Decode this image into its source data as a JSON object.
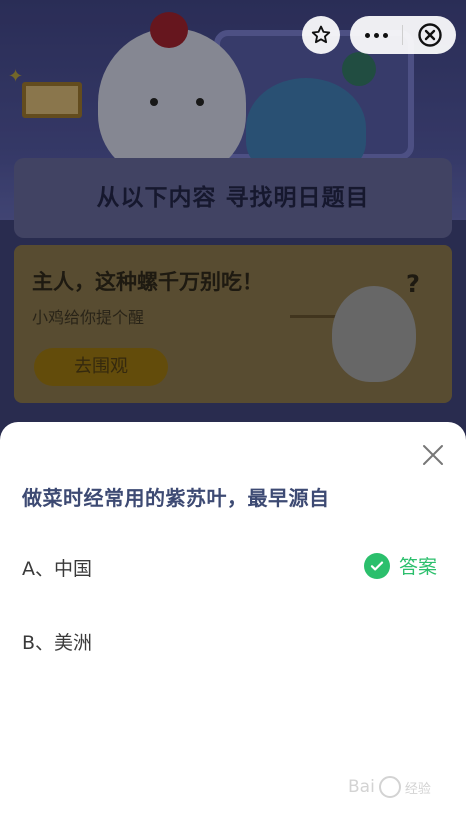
{
  "top_actions": {
    "favorite_icon": "star-outline-icon",
    "more_icon": "more-dots-icon",
    "close_icon": "circle-close-icon"
  },
  "background_page": {
    "banner_title": "从以下内容 寻找明日题目",
    "card": {
      "title": "主人，这种螺千万别吃！",
      "subtitle": "小鸡给你提个醒",
      "button_label": "去围观",
      "question_mark": "?"
    }
  },
  "quiz": {
    "question": "做菜时经常用的紫苏叶，最早源自",
    "options": [
      {
        "label": "A、中国",
        "is_answer": true
      },
      {
        "label": "B、美洲",
        "is_answer": false
      }
    ],
    "answer_label": "答案",
    "answer_color": "#2bbf6c"
  },
  "watermark": {
    "brand": "Bai",
    "suffix": "经验"
  }
}
